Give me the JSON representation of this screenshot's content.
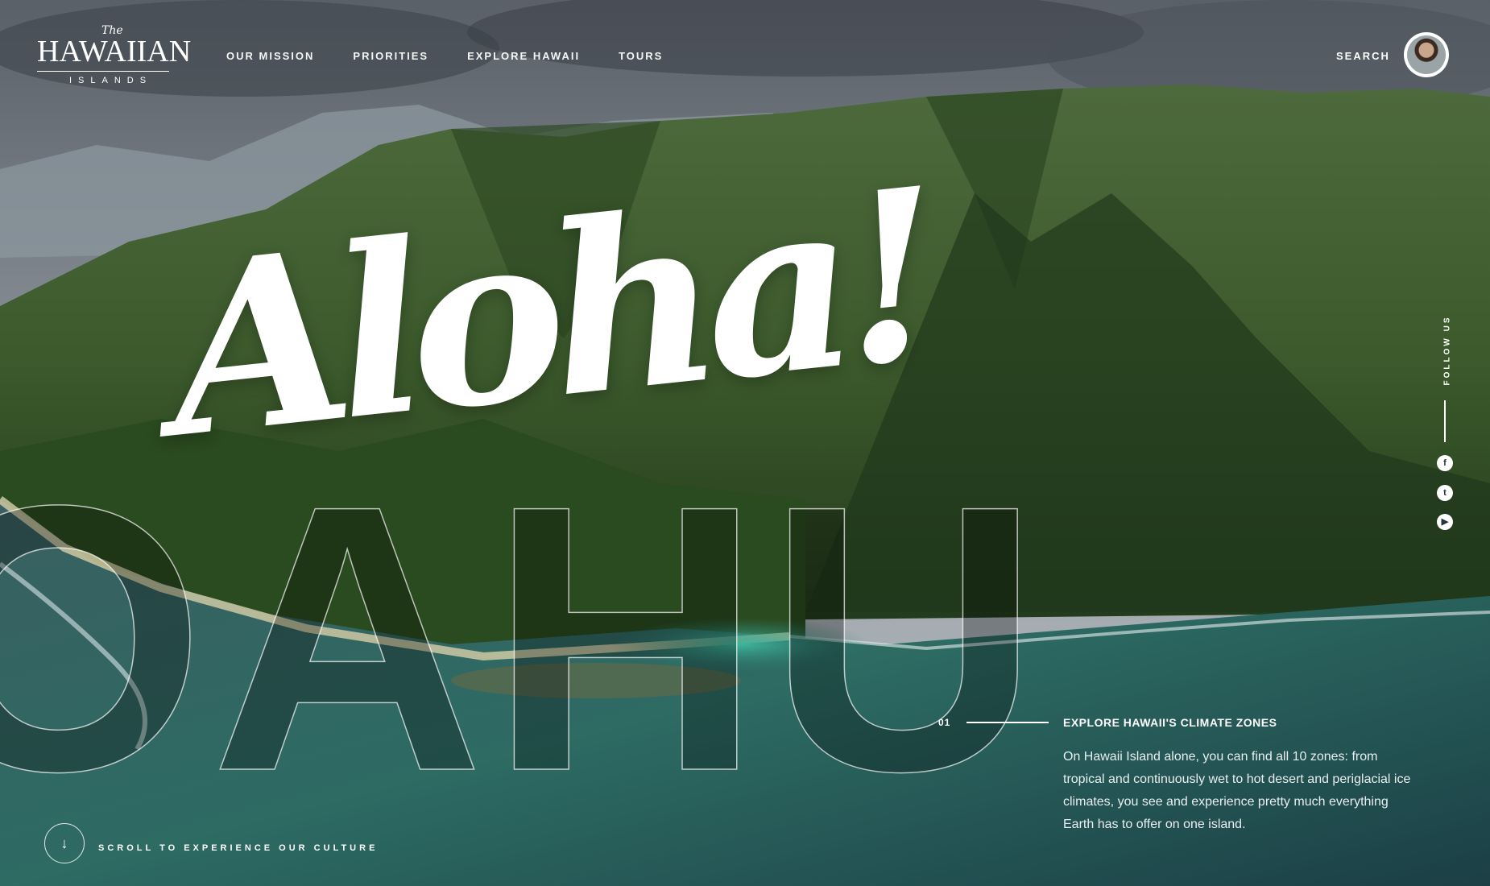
{
  "logo": {
    "the": "The",
    "brand": "HAWAIIAN",
    "sub": "ISLANDS"
  },
  "nav": [
    {
      "label": "OUR MISSION"
    },
    {
      "label": "PRIORITIES"
    },
    {
      "label": "EXPLORE HAWAII"
    },
    {
      "label": "TOURS"
    }
  ],
  "header": {
    "search": "SEARCH"
  },
  "hero": {
    "headline": "Aloha!",
    "island": "OAHU"
  },
  "social": {
    "follow_label": "FOLLOW US",
    "icons": [
      "facebook-icon",
      "twitter-icon",
      "youtube-icon"
    ]
  },
  "info": {
    "number": "01",
    "title": "EXPLORE HAWAII'S CLIMATE ZONES",
    "text": "On Hawaii Island alone, you can find all 10 zones: from tropical and continuously wet to hot desert and periglacial ice climates, you see and experience pretty much everything Earth has to offer on one island."
  },
  "scroll": {
    "label": "SCROLL TO EXPERIENCE OUR CULTURE"
  }
}
